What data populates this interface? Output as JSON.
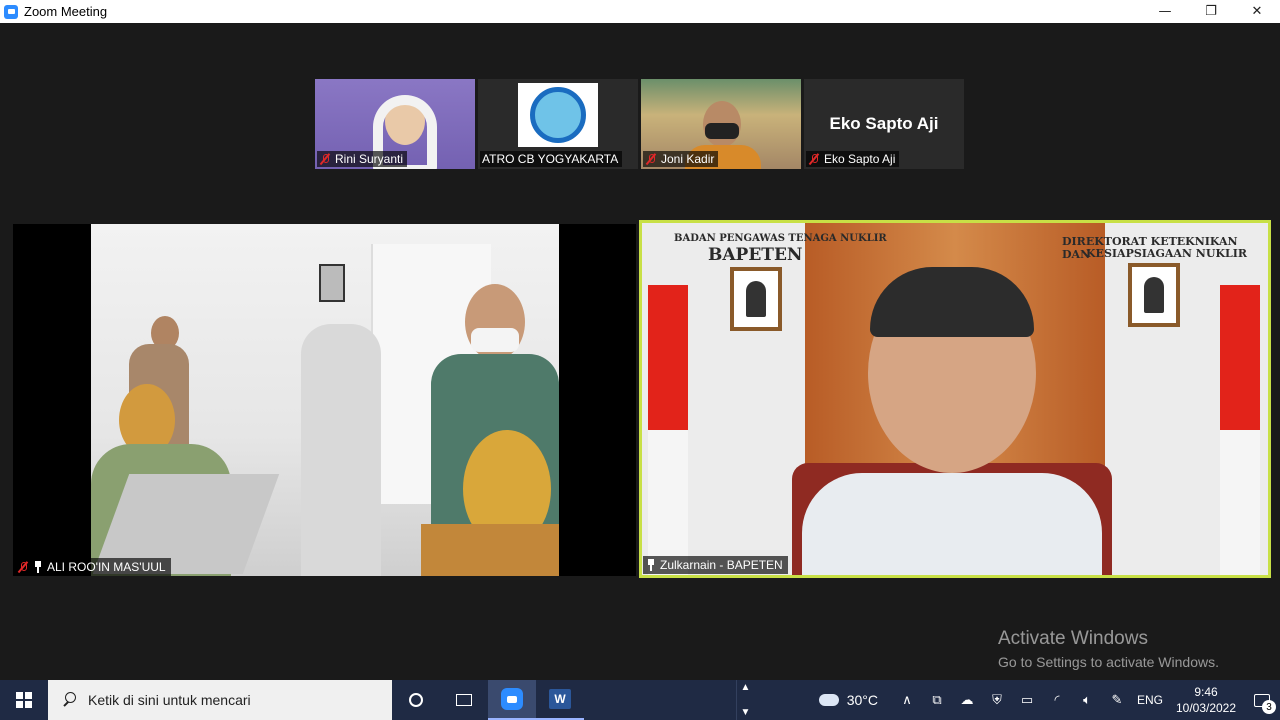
{
  "window": {
    "title": "Zoom Meeting",
    "minimize_icon": "—",
    "restore_icon": "❐",
    "close_icon": "✕"
  },
  "participants_strip": [
    {
      "name": "Rini Suryanti",
      "muted": true
    },
    {
      "name": "ATRO CB YOGYAKARTA",
      "muted": false
    },
    {
      "name": "Joni Kadir",
      "muted": true
    },
    {
      "name": "Eko Sapto Aji",
      "muted": true,
      "display_name": "Eko Sapto Aji"
    }
  ],
  "main_videos": [
    {
      "name": "ALI ROO'IN MAS'UUL",
      "muted": true,
      "pinned": true
    },
    {
      "name": "Zulkarnain - BAPETEN",
      "muted": false,
      "pinned": true,
      "active_speaker": true,
      "background_text": {
        "left_line1": "BADAN PENGAWAS TENAGA NUKLIR",
        "left_line2": "BAPETEN",
        "right_line1": "DIREKTORAT KETEKNIKAN DAN",
        "right_line2": "KESIAPSIAGAAN NUKLIR"
      }
    }
  ],
  "watermark": {
    "line1": "Activate Windows",
    "line2": "Go to Settings to activate Windows."
  },
  "taskbar": {
    "search_placeholder": "Ketik di sini untuk mencari",
    "weather": "30°C",
    "language": "ENG",
    "time": "9:46",
    "date": "10/03/2022",
    "notification_count": "3",
    "word_letter": "W"
  },
  "colors": {
    "active_speaker_border": "#c8e046",
    "taskbar_bg": "#1f2a44",
    "zoom_blue": "#2d8cff",
    "muted_red": "#e02828"
  }
}
